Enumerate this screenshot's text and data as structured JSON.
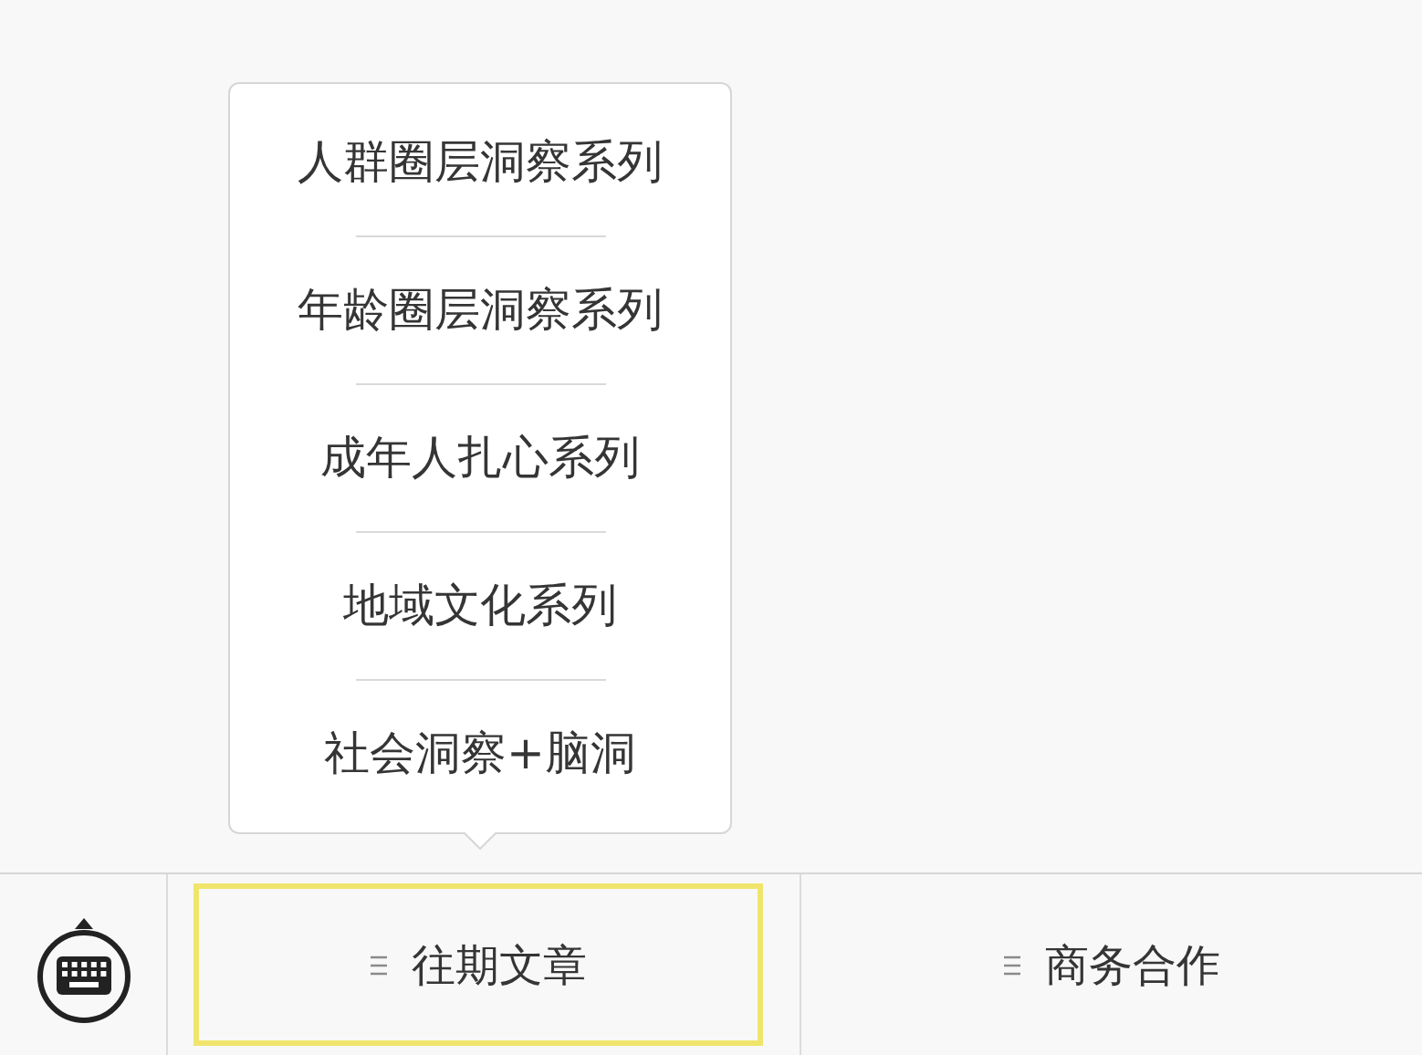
{
  "menus": [
    {
      "label": "往期文章",
      "selected": true,
      "submenu": [
        {
          "label": "人群圈层洞察系列"
        },
        {
          "label": "年龄圈层洞察系列"
        },
        {
          "label": "成年人扎心系列"
        },
        {
          "label": "地域文化系列"
        },
        {
          "label": "社会洞察+脑洞"
        }
      ]
    },
    {
      "label": "商务合作",
      "selected": false
    }
  ]
}
